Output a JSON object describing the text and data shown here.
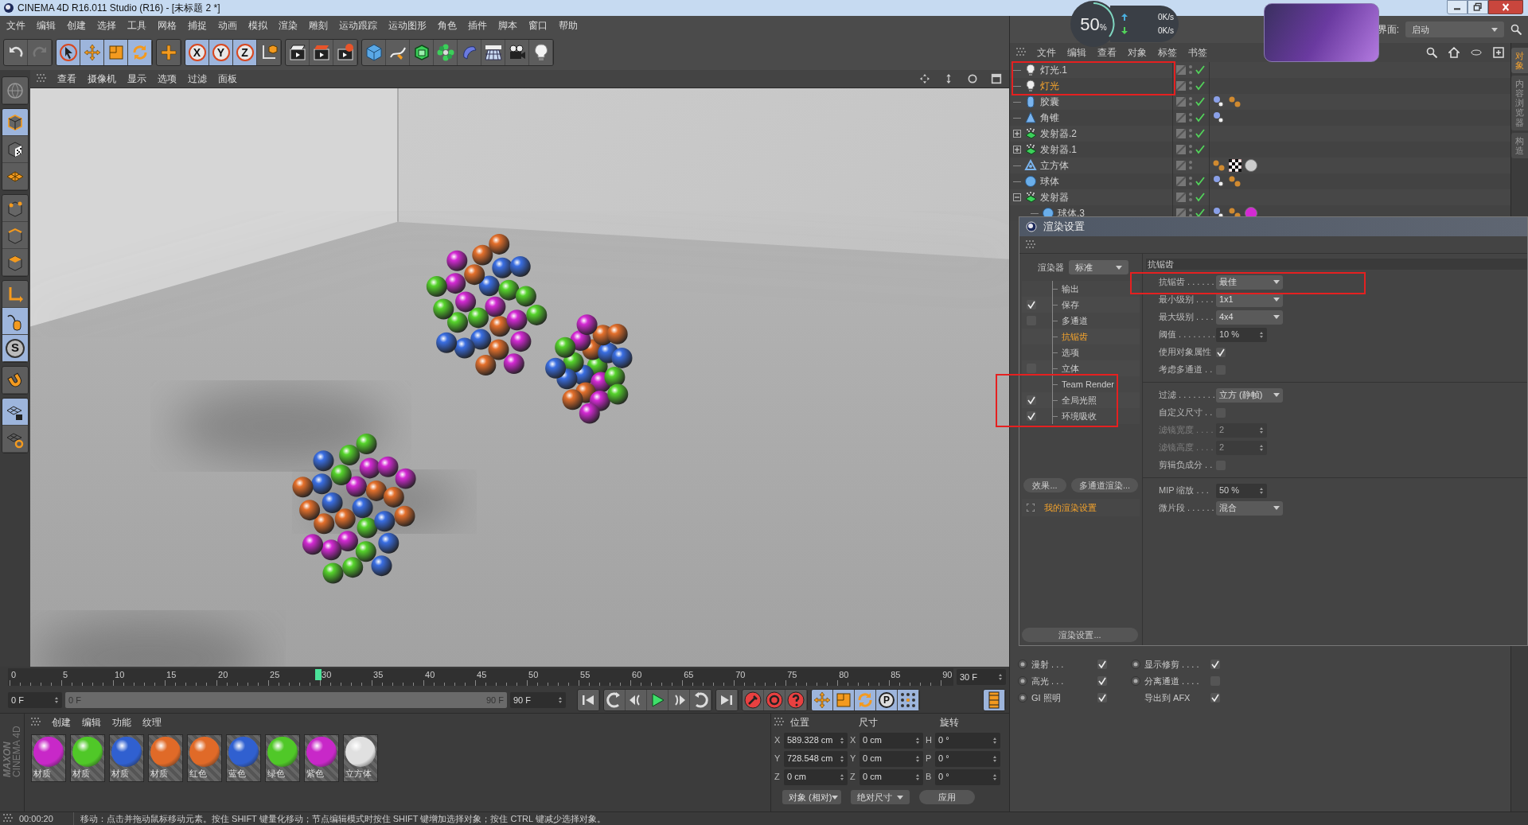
{
  "window": {
    "title": "CINEMA 4D R16.011 Studio (R16) - [未标题 2 *]"
  },
  "menu": [
    "文件",
    "编辑",
    "创建",
    "选择",
    "工具",
    "网格",
    "捕捉",
    "动画",
    "模拟",
    "渲染",
    "雕刻",
    "运动跟踪",
    "运动图形",
    "角色",
    "插件",
    "脚本",
    "窗口",
    "帮助"
  ],
  "toolbar": {
    "axis_labels": [
      "X",
      "Y",
      "Z"
    ]
  },
  "left_toolbar": {
    "snap_label": "S"
  },
  "viewport": {
    "menu": [
      "查看",
      "摄像机",
      "显示",
      "选项",
      "过滤",
      "面板"
    ]
  },
  "net_monitor": {
    "percent": "50",
    "unit": "%",
    "upload": "0K/s",
    "download": "0K/s"
  },
  "layout": {
    "label": "界面:",
    "value": "启动"
  },
  "object_manager": {
    "menu": [
      "文件",
      "编辑",
      "查看",
      "对象",
      "标签",
      "书签"
    ],
    "objects": [
      {
        "name": "灯光.1",
        "kind": "light",
        "selected": false,
        "checked": true
      },
      {
        "name": "灯光",
        "kind": "light",
        "selected": true,
        "checked": true
      },
      {
        "name": "胶囊",
        "kind": "capsule",
        "selected": false,
        "checked": true,
        "tags": [
          {
            "kind": "phong"
          },
          {
            "kind": "material"
          }
        ]
      },
      {
        "name": "角锥",
        "kind": "cone",
        "selected": false,
        "checked": true,
        "tags": [
          {
            "kind": "phong"
          }
        ]
      },
      {
        "name": "发射器.2",
        "kind": "emitter",
        "selected": false,
        "checked": true,
        "expanded": false
      },
      {
        "name": "发射器.1",
        "kind": "emitter",
        "selected": false,
        "checked": true,
        "expanded": false
      },
      {
        "name": "立方体",
        "kind": "cube",
        "selected": false,
        "checked": false,
        "tags": [
          {
            "kind": "material"
          },
          {
            "kind": "checker"
          },
          {
            "kind": "sphere"
          }
        ]
      },
      {
        "name": "球体",
        "kind": "sphere",
        "selected": false,
        "checked": true,
        "tags": [
          {
            "kind": "phong"
          },
          {
            "kind": "material"
          }
        ]
      },
      {
        "name": "发射器",
        "kind": "emitter",
        "selected": false,
        "checked": true,
        "expanded": true,
        "children": [
          {
            "name": "球体.3",
            "kind": "sphere",
            "selected": false,
            "checked": true,
            "tags": [
              {
                "kind": "phong"
              },
              {
                "kind": "material"
              },
              {
                "kind": "swatch"
              }
            ]
          }
        ]
      }
    ]
  },
  "side_tabs": [
    {
      "label": "对象",
      "selected": true
    },
    {
      "label": "内容浏览器",
      "selected": false
    },
    {
      "label": "构造",
      "selected": false
    }
  ],
  "render_settings": {
    "title": "渲染设置",
    "renderer_label": "渲染器",
    "renderer": "标准",
    "items": [
      {
        "label": "输出",
        "kind": "plain",
        "selected": false
      },
      {
        "label": "保存",
        "kind": "checkbox",
        "checked": true,
        "selected": false
      },
      {
        "label": "多通道",
        "kind": "checkbox",
        "checked": false,
        "selected": false
      },
      {
        "label": "抗锯齿",
        "kind": "plain",
        "selected": true
      },
      {
        "label": "选项",
        "kind": "plain",
        "selected": false
      },
      {
        "label": "立体",
        "kind": "checkbox",
        "checked": false,
        "selected": false
      },
      {
        "label": "Team Render",
        "kind": "plain",
        "selected": false
      },
      {
        "label": "全局光照",
        "kind": "checkbox",
        "checked": true,
        "selected": false
      },
      {
        "label": "环境吸收",
        "kind": "checkbox",
        "checked": true,
        "selected": false
      }
    ],
    "buttons": [
      "效果...",
      "多通道渲染..."
    ],
    "preset": "我的渲染设置",
    "footer_button": "渲染设置...",
    "section_title": "抗锯齿",
    "groups": [
      [
        {
          "label": "抗锯齿 . . . . . .",
          "kind": "dropdown",
          "value": "最佳",
          "disabled": false
        },
        {
          "label": "最小级别 . . . .",
          "kind": "dropdown",
          "value": "1x1",
          "disabled": false
        },
        {
          "label": "最大级别 . . . .",
          "kind": "dropdown",
          "value": "4x4",
          "disabled": false
        },
        {
          "label": "阈值 . . . . . . . .",
          "kind": "number",
          "value": "10 %",
          "disabled": false
        },
        {
          "label": "使用对象属性",
          "kind": "checkbox",
          "checked": true,
          "disabled": false
        },
        {
          "label": "考虑多通道 . .",
          "kind": "checkbox",
          "checked": false,
          "disabled": false
        }
      ],
      [
        {
          "label": "过滤 . . . . . . . .",
          "kind": "dropdown",
          "value": "立方 (静帧)",
          "disabled": false
        },
        {
          "label": "自定义尺寸 . .",
          "kind": "checkbox",
          "checked": false,
          "disabled": false
        },
        {
          "label": "滤镜宽度 . . . .",
          "kind": "number",
          "value": "2",
          "disabled": true
        },
        {
          "label": "滤镜高度 . . . .",
          "kind": "number",
          "value": "2",
          "disabled": true
        },
        {
          "label": "剪辑负成分 . .",
          "kind": "checkbox",
          "checked": false,
          "disabled": false
        }
      ],
      [
        {
          "label": "MIP 缩放 . . .",
          "kind": "number",
          "value": "50 %",
          "disabled": false
        },
        {
          "label": "微片段 . . . . . .",
          "kind": "dropdown",
          "value": "混合",
          "disabled": false
        }
      ]
    ]
  },
  "attributes": {
    "columns": [
      [
        {
          "label": "漫射 . . .",
          "kind": "radio",
          "checked": true
        },
        {
          "label": "高光 . . .",
          "kind": "radio",
          "checked": true
        },
        {
          "label": "GI 照明",
          "kind": "radio",
          "checked": true
        }
      ],
      [
        {
          "label": "显示修剪 . . . .",
          "kind": "radio",
          "checked": true
        },
        {
          "label": "分离通道 . . . .",
          "kind": "radio",
          "checked": false
        },
        {
          "label": "导出到 AFX",
          "kind": "plain",
          "checked": true
        }
      ]
    ]
  },
  "timeline": {
    "ticks": [
      "0",
      "5",
      "10",
      "15",
      "20",
      "25",
      "30",
      "35",
      "40",
      "45",
      "50",
      "55",
      "60",
      "65",
      "70",
      "75",
      "80",
      "85",
      "90"
    ],
    "playhead": {
      "level": 0.3333
    },
    "frame_field": "30 F"
  },
  "playback": {
    "start": "0 F",
    "range_start": "0 F",
    "range_end": "90 F",
    "end": "90 F",
    "key_label": "P"
  },
  "materials": {
    "menu": [
      "创建",
      "编辑",
      "功能",
      "纹理"
    ],
    "items": [
      {
        "name": "材质",
        "color": "#c828c8"
      },
      {
        "name": "材质",
        "color": "#50c828"
      },
      {
        "name": "材质",
        "color": "#3060d0"
      },
      {
        "name": "材质",
        "color": "#e06a28"
      },
      {
        "name": "红色",
        "color": "#e06a28"
      },
      {
        "name": "蓝色",
        "color": "#3060d0"
      },
      {
        "name": "绿色",
        "color": "#50c828"
      },
      {
        "name": "紫色",
        "color": "#c828c8"
      },
      {
        "name": "立方体",
        "color": "#e0e0e0"
      }
    ]
  },
  "coordinates": {
    "headers": [
      "位置",
      "尺寸",
      "旋转"
    ],
    "rows": [
      {
        "axis": "X",
        "position": "589.328 cm",
        "size_axis": "X",
        "size": "0 cm",
        "rotation_axis": "H",
        "rotation": "0 °"
      },
      {
        "axis": "Y",
        "position": "728.548 cm",
        "size_axis": "Y",
        "size": "0 cm",
        "rotation_axis": "P",
        "rotation": "0 °"
      },
      {
        "axis": "Z",
        "position": "0 cm",
        "size_axis": "Z",
        "size": "0 cm",
        "rotation_axis": "B",
        "rotation": "0 °"
      }
    ],
    "mode": "对象 (相对)",
    "size_mode": "绝对尺寸",
    "apply": "应用"
  },
  "brand": [
    "MAXON",
    "CINEMA 4D"
  ],
  "status_bar": {
    "time": "00:00:20",
    "message": "移动：点击并拖动鼠标移动元素。按住 SHIFT 键量化移动；节点编辑模式时按住 SHIFT 键增加选择对象；按住 CTRL 键减少选择对象。"
  }
}
